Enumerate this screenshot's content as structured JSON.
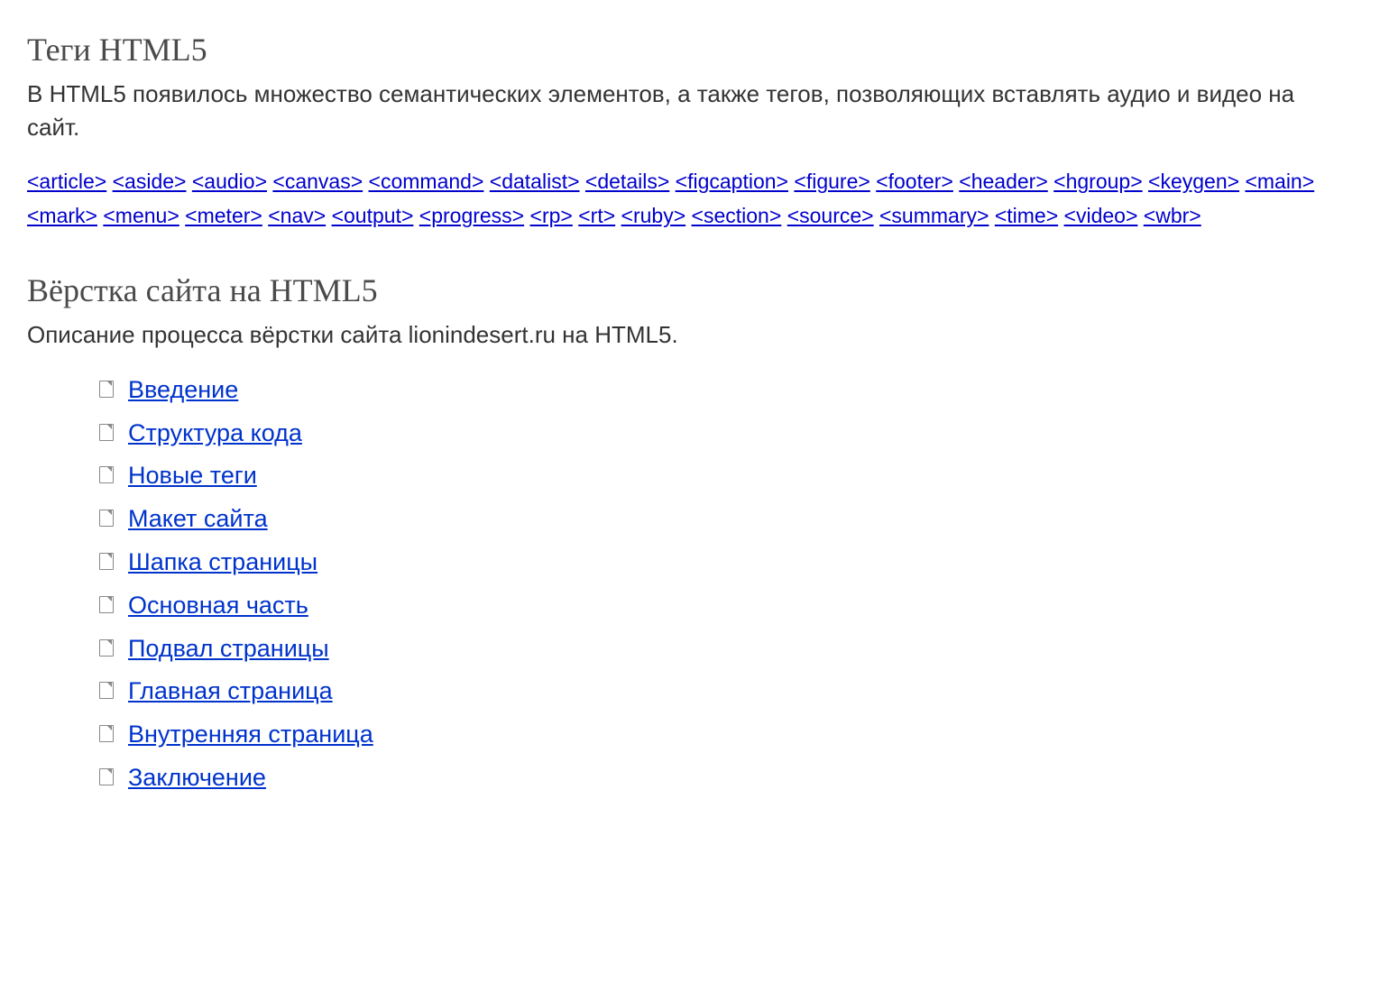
{
  "section1": {
    "heading": "Теги HTML5",
    "description": "В HTML5 появилось множество семантических элементов, а также тегов, позволяющих вставлять аудио и видео на сайт.",
    "tags": [
      "<article>",
      "<aside>",
      "<audio>",
      "<canvas>",
      "<command>",
      "<datalist>",
      "<details>",
      "<figcaption>",
      "<figure>",
      "<footer>",
      "<header>",
      "<hgroup>",
      "<keygen>",
      "<main>",
      "<mark>",
      "<menu>",
      "<meter>",
      "<nav>",
      "<output>",
      "<progress>",
      "<rp>",
      "<rt>",
      "<ruby>",
      "<section>",
      "<source>",
      "<summary>",
      "<time>",
      "<video>",
      "<wbr>"
    ]
  },
  "section2": {
    "heading": "Вёрстка сайта на HTML5",
    "description": "Описание процесса вёрстки сайта lionindesert.ru на HTML5.",
    "items": [
      "Введение",
      "Структура кода",
      "Новые теги",
      "Макет сайта",
      "Шапка страницы",
      "Основная часть",
      "Подвал страницы",
      "Главная страница",
      "Внутренняя страница",
      "Заключение"
    ]
  }
}
